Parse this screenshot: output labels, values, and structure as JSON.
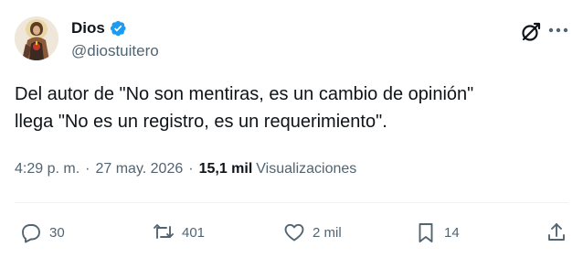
{
  "author": {
    "display_name": "Dios",
    "handle": "@diostuitero",
    "verified": true,
    "avatar": "sacred-heart-figure-avatar"
  },
  "header_icons": {
    "grok": "grok-icon",
    "more": "more-options-icon"
  },
  "tweet": {
    "line1": "Del autor de \"No son mentiras, es un cambio de opinión\"",
    "line2": "llega \"No es un registro, es un requerimiento\"."
  },
  "meta": {
    "time": "4:29 p. m.",
    "separator": "·",
    "date": "27 may. 2026",
    "views_count": "15,1 mil",
    "views_label": "Visualizaciones"
  },
  "actions": {
    "reply_count": "30",
    "retweet_count": "401",
    "like_count": "2 mil",
    "bookmark_count": "14"
  },
  "colors": {
    "text": "#0f1419",
    "secondary": "#536471",
    "verified": "#1d9bf0",
    "divider": "#eff3f4"
  }
}
